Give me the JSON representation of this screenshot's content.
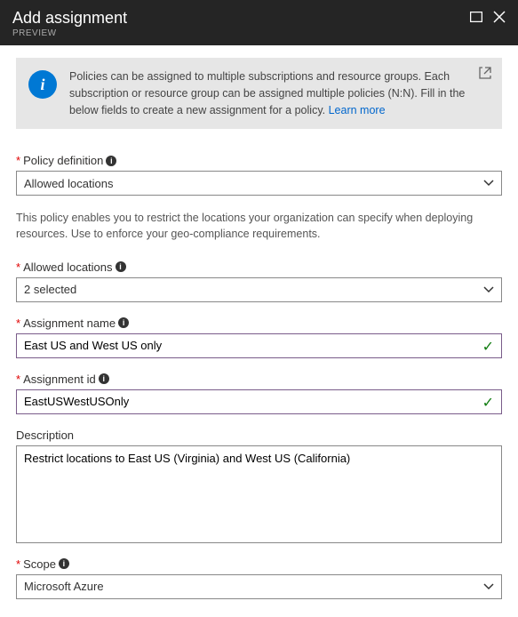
{
  "header": {
    "title": "Add assignment",
    "subtitle": "PREVIEW"
  },
  "info": {
    "text": "Policies can be assigned to multiple subscriptions and resource groups. Each subscription or resource group can be assigned multiple policies (N:N).  Fill in the below fields to create a new assignment for a policy.  ",
    "link": "Learn more"
  },
  "fields": {
    "policyDefinition": {
      "label": "Policy definition",
      "value": "Allowed locations",
      "description": "This policy enables you to restrict the locations your organization can specify when deploying resources. Use to enforce your geo-compliance requirements."
    },
    "allowedLocations": {
      "label": "Allowed locations",
      "value": "2 selected"
    },
    "assignmentName": {
      "label": "Assignment name",
      "value": "East US and West US only"
    },
    "assignmentId": {
      "label": "Assignment id",
      "value": "EastUSWestUSOnly"
    },
    "description": {
      "label": "Description",
      "value": "Restrict locations to East US (Virginia) and West US (California)"
    },
    "scope": {
      "label": "Scope",
      "value": "Microsoft Azure"
    }
  }
}
